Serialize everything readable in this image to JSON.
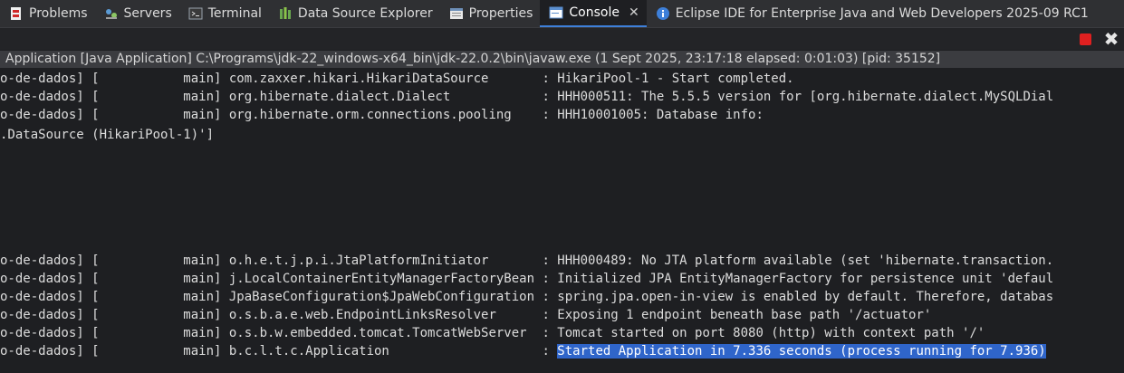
{
  "tabs": [
    {
      "label": "Problems",
      "icon": "problems-icon"
    },
    {
      "label": "Servers",
      "icon": "servers-icon"
    },
    {
      "label": "Terminal",
      "icon": "terminal-icon"
    },
    {
      "label": "Data Source Explorer",
      "icon": "data-source-icon"
    },
    {
      "label": "Properties",
      "icon": "properties-icon"
    },
    {
      "label": "Console",
      "icon": "console-icon",
      "active": true
    },
    {
      "label": "Eclipse IDE for Enterprise Java and Web Developers 2025-09 RC1",
      "icon": "info-icon"
    }
  ],
  "toolbar": {
    "terminate": "terminate-icon",
    "remove": "remove-launch-icon"
  },
  "status": "Application [Java Application] C:\\Programs\\jdk-22_windows-x64_bin\\jdk-22.0.2\\bin\\javaw.exe  (1 Sept 2025, 23:17:18 elapsed: 0:01:03) [pid: 35152]",
  "console": {
    "lines": [
      "o-de-dados] [           main] com.zaxxer.hikari.HikariDataSource       : HikariPool-1 - Start completed.",
      "o-de-dados] [           main] org.hibernate.dialect.Dialect            : HHH000511: The 5.5.5 version for [org.hibernate.dialect.MySQLDial",
      "o-de-dados] [           main] org.hibernate.orm.connections.pooling    : HHH10001005: Database info:",
      ".DataSource (HikariPool-1)']",
      "o-de-dados] [           main] o.h.e.t.j.p.i.JtaPlatformInitiator       : HHH000489: No JTA platform available (set 'hibernate.transaction.",
      "o-de-dados] [           main] j.LocalContainerEntityManagerFactoryBean : Initialized JPA EntityManagerFactory for persistence unit 'defaul",
      "o-de-dados] [           main] JpaBaseConfiguration$JpaWebConfiguration : spring.jpa.open-in-view is enabled by default. Therefore, databas",
      "o-de-dados] [           main] o.s.b.a.e.web.EndpointLinksResolver      : Exposing 1 endpoint beneath base path '/actuator'",
      "o-de-dados] [           main] o.s.b.w.embedded.tomcat.TomcatWebServer  : Tomcat started on port 8080 (http) with context path '/'",
      "o-de-dados] [           main] b.c.l.t.c.Application                    : "
    ],
    "highlighted": "Started Application in 7.336 seconds (process running for 7.936)"
  }
}
